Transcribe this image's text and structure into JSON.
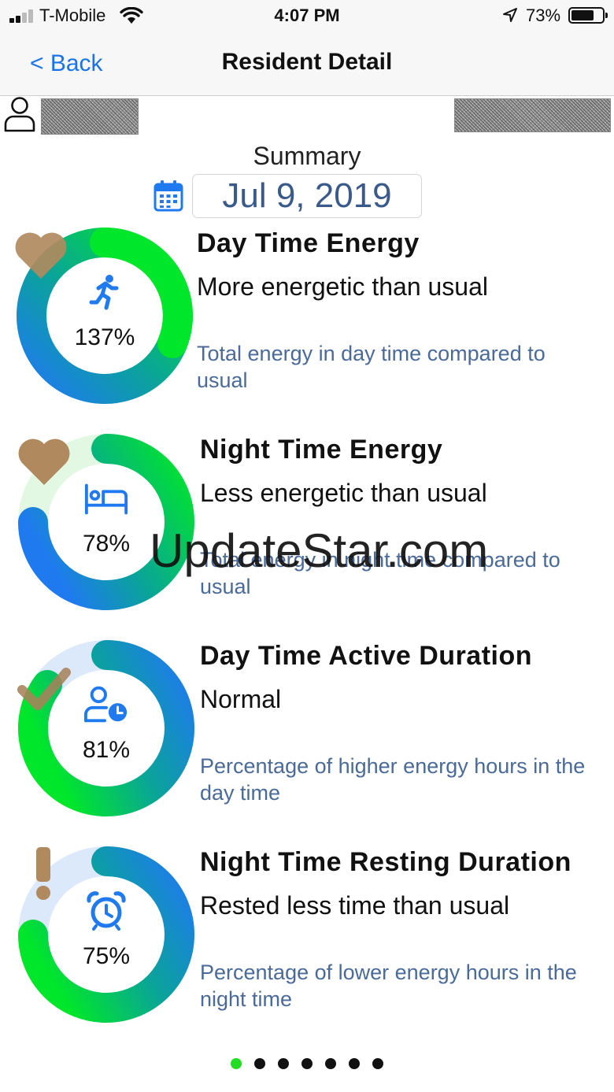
{
  "status_bar": {
    "carrier": "T-Mobile",
    "time": "4:07 PM",
    "battery": "73%"
  },
  "nav": {
    "back_label": "< Back",
    "title": "Resident Detail"
  },
  "summary": {
    "title": "Summary",
    "date": "Jul 9, 2019"
  },
  "colors": {
    "green": "#00e62a",
    "blue": "#1f7af0",
    "teal": "#0aa39a",
    "track": "#dce9fb",
    "heart": "#b08a5e",
    "description": "#4a6a9a"
  },
  "metrics": [
    {
      "title": "Day Time Energy",
      "status": "More energetic than usual",
      "description": "Total energy in day time compared to usual",
      "percent_label": "137%",
      "fraction": 1.37,
      "icon": "running-person-icon",
      "status_icon": "heart-icon"
    },
    {
      "title": "Night Time Energy",
      "status": "Less energetic than usual",
      "description": "Total energy in night time compared to usual",
      "percent_label": "78%",
      "fraction": 0.78,
      "icon": "bed-icon",
      "status_icon": "heart-icon"
    },
    {
      "title": "Day Time Active Duration",
      "status": "Normal",
      "description": "Percentage of higher energy hours in the day time",
      "percent_label": "81%",
      "fraction": 0.81,
      "icon": "person-clock-icon",
      "status_icon": "checkmark-icon"
    },
    {
      "title": "Night Time Resting Duration",
      "status": "Rested less time than usual",
      "description": "Percentage of lower energy hours in the night time",
      "percent_label": "75%",
      "fraction": 0.75,
      "icon": "alarm-clock-icon",
      "status_icon": "exclamation-icon"
    }
  ],
  "pagination": {
    "total": 7,
    "active": 0
  },
  "watermark": "UpdateStar.com"
}
